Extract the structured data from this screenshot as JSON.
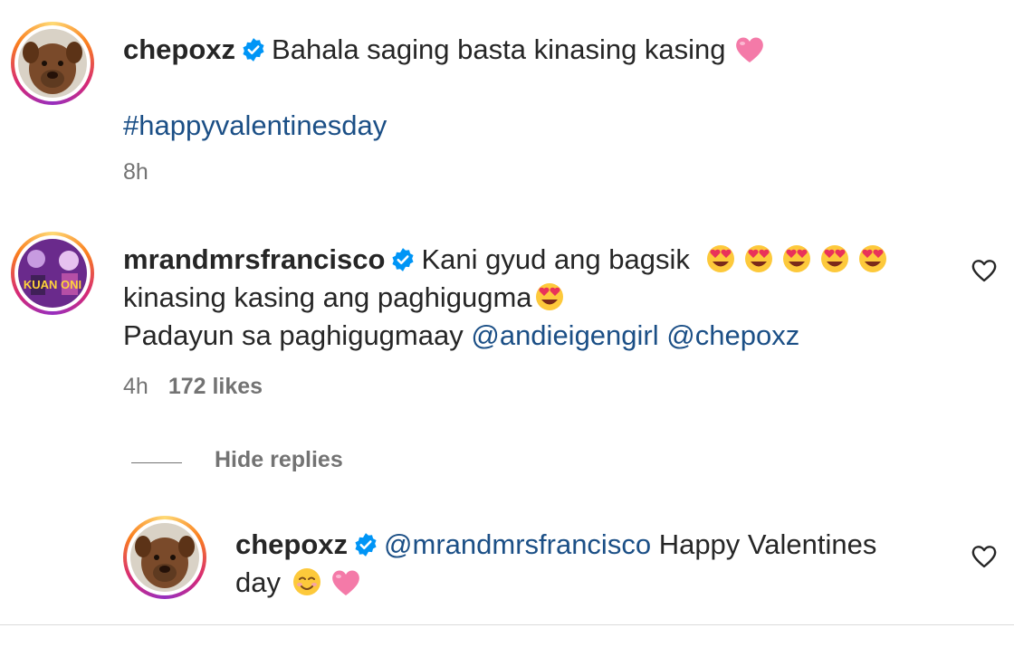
{
  "post": {
    "username": "chepoxz",
    "caption": "Bahala saging basta kinasing kasing",
    "hashtag": "#happyvalentinesday",
    "time": "8h"
  },
  "comment": {
    "username": "mrandmrsfrancisco",
    "line1": "Kani gyud ang bagsik",
    "line2": "kinasing kasing ang paghigugma",
    "line3": "Padayun sa paghigugmaay",
    "mention1": "@andieigengirl",
    "mention2": "@chepoxz",
    "time": "4h",
    "likes": "172 likes",
    "avatar_text": "KUAN ONI"
  },
  "replies": {
    "toggle_label": "Hide replies"
  },
  "reply": {
    "username": "chepoxz",
    "mention": "@mrandmrsfrancisco",
    "text1": "Happy Valentines",
    "text2": "day"
  },
  "colors": {
    "link": "#1b4f86",
    "verified": "#0095f6",
    "muted": "#737373",
    "heart_emoji": "#f47aa8"
  }
}
